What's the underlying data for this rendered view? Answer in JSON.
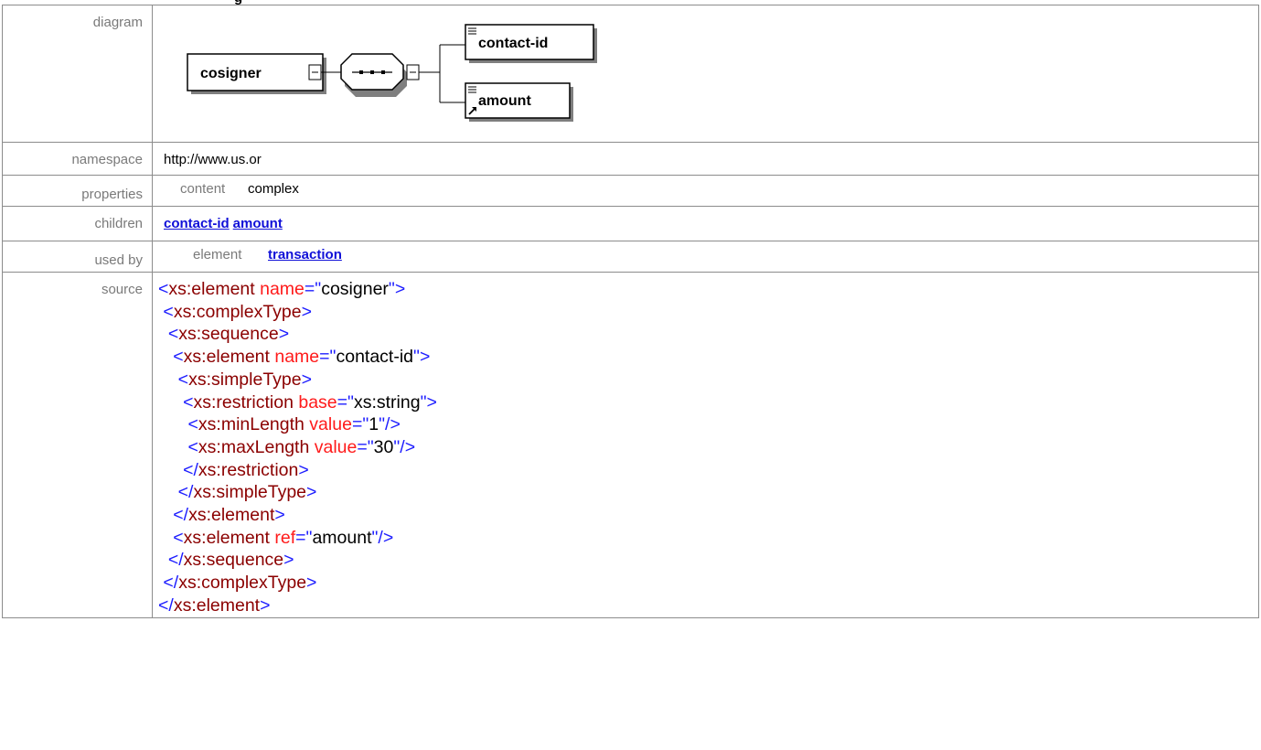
{
  "top_fragment": "g",
  "rows": {
    "diagram": {
      "label": "diagram"
    },
    "namespace": {
      "label": "namespace",
      "value": "http://www.us.or"
    },
    "properties": {
      "label": "properties",
      "key": "content",
      "value": "complex"
    },
    "children": {
      "label": "children",
      "links": [
        "contact-id",
        "amount"
      ]
    },
    "used_by": {
      "label": "used by",
      "key": "element",
      "link": "transaction"
    },
    "source": {
      "label": "source"
    }
  },
  "diagram": {
    "root": "cosigner",
    "child1": "contact-id",
    "child2": "amount"
  },
  "source_lines": [
    [
      [
        "t",
        "<"
      ],
      [
        "tn",
        "xs:element"
      ],
      [
        "an",
        " name"
      ],
      [
        "t",
        "=\""
      ],
      [
        "av",
        "cosigner"
      ],
      [
        "t",
        "\">"
      ]
    ],
    [
      [
        "av",
        " "
      ],
      [
        "t",
        "<"
      ],
      [
        "tn",
        "xs:complexType"
      ],
      [
        "t",
        ">"
      ]
    ],
    [
      [
        "av",
        "  "
      ],
      [
        "t",
        "<"
      ],
      [
        "tn",
        "xs:sequence"
      ],
      [
        "t",
        ">"
      ]
    ],
    [
      [
        "av",
        "   "
      ],
      [
        "t",
        "<"
      ],
      [
        "tn",
        "xs:element"
      ],
      [
        "an",
        " name"
      ],
      [
        "t",
        "=\""
      ],
      [
        "av",
        "contact-id"
      ],
      [
        "t",
        "\">"
      ]
    ],
    [
      [
        "av",
        "    "
      ],
      [
        "t",
        "<"
      ],
      [
        "tn",
        "xs:simpleType"
      ],
      [
        "t",
        ">"
      ]
    ],
    [
      [
        "av",
        "     "
      ],
      [
        "t",
        "<"
      ],
      [
        "tn",
        "xs:restriction"
      ],
      [
        "an",
        " base"
      ],
      [
        "t",
        "=\""
      ],
      [
        "av",
        "xs:string"
      ],
      [
        "t",
        "\">"
      ]
    ],
    [
      [
        "av",
        "      "
      ],
      [
        "t",
        "<"
      ],
      [
        "tn",
        "xs:minLength"
      ],
      [
        "an",
        " value"
      ],
      [
        "t",
        "=\""
      ],
      [
        "av",
        "1"
      ],
      [
        "t",
        "\"/>"
      ]
    ],
    [
      [
        "av",
        "      "
      ],
      [
        "t",
        "<"
      ],
      [
        "tn",
        "xs:maxLength"
      ],
      [
        "an",
        " value"
      ],
      [
        "t",
        "=\""
      ],
      [
        "av",
        "30"
      ],
      [
        "t",
        "\"/>"
      ]
    ],
    [
      [
        "av",
        "     "
      ],
      [
        "t",
        "</"
      ],
      [
        "tn",
        "xs:restriction"
      ],
      [
        "t",
        ">"
      ]
    ],
    [
      [
        "av",
        "    "
      ],
      [
        "t",
        "</"
      ],
      [
        "tn",
        "xs:simpleType"
      ],
      [
        "t",
        ">"
      ]
    ],
    [
      [
        "av",
        "   "
      ],
      [
        "t",
        "</"
      ],
      [
        "tn",
        "xs:element"
      ],
      [
        "t",
        ">"
      ]
    ],
    [
      [
        "av",
        "   "
      ],
      [
        "t",
        "<"
      ],
      [
        "tn",
        "xs:element"
      ],
      [
        "an",
        " ref"
      ],
      [
        "t",
        "=\""
      ],
      [
        "av",
        "amount"
      ],
      [
        "t",
        "\"/>"
      ]
    ],
    [
      [
        "av",
        "  "
      ],
      [
        "t",
        "</"
      ],
      [
        "tn",
        "xs:sequence"
      ],
      [
        "t",
        ">"
      ]
    ],
    [
      [
        "av",
        " "
      ],
      [
        "t",
        "</"
      ],
      [
        "tn",
        "xs:complexType"
      ],
      [
        "t",
        ">"
      ]
    ],
    [
      [
        "t",
        "</"
      ],
      [
        "tn",
        "xs:element"
      ],
      [
        "t",
        ">"
      ]
    ]
  ],
  "colors": {
    "tag_bracket": "#1c1cff",
    "tag_name": "#8b0000",
    "attr_name": "#ff1a1a",
    "attr_value": "#000000",
    "link": "#1010d8",
    "label": "#7a7a7a",
    "border": "#8c8c8c"
  }
}
